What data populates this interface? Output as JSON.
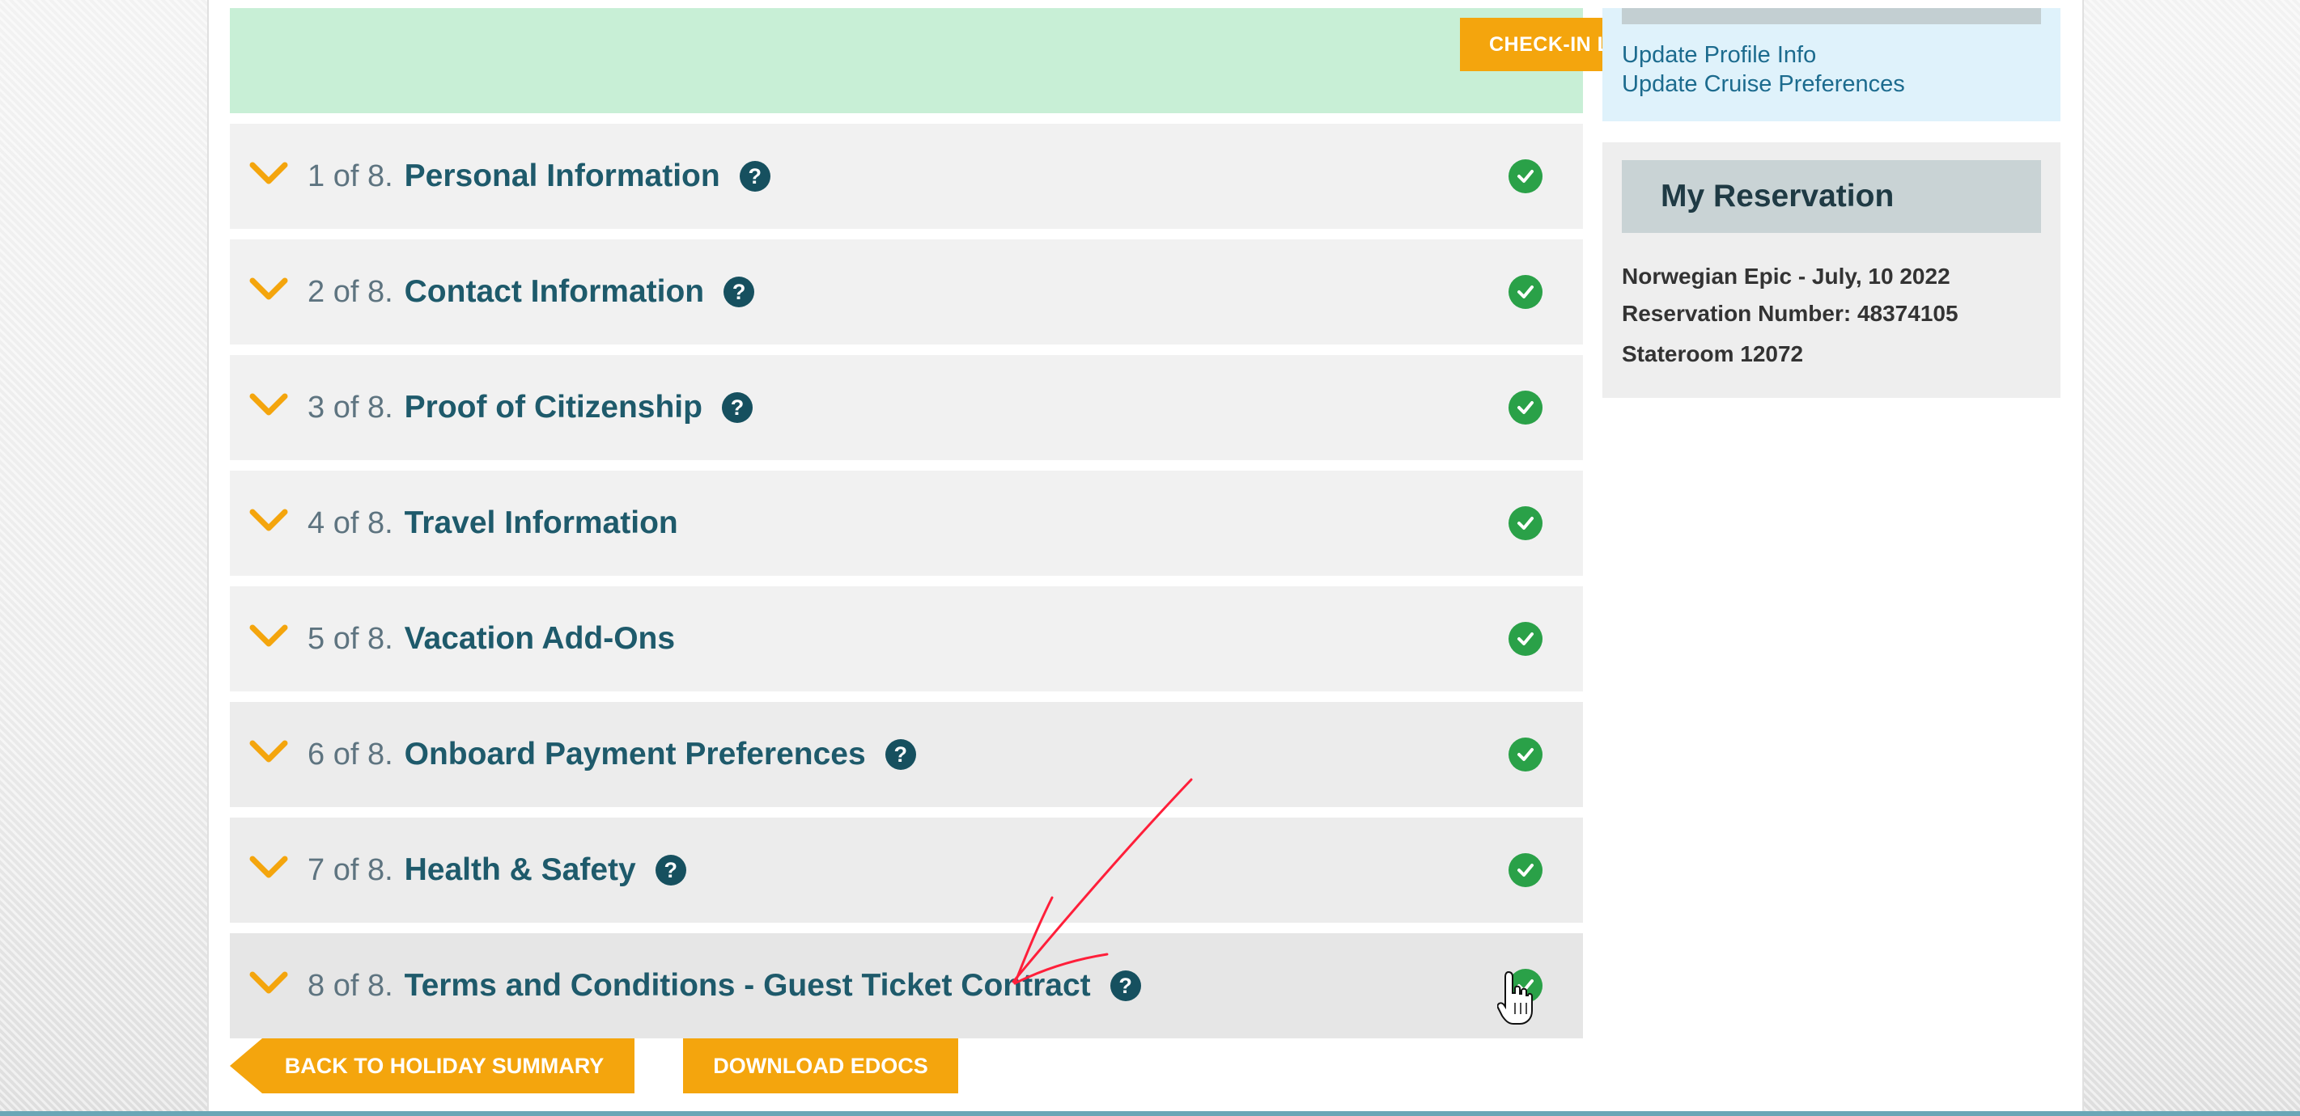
{
  "checkin": {
    "button_label": "CHECK-IN LOTTE"
  },
  "steps": [
    {
      "number": "1 of 8.",
      "title": "Personal Information",
      "has_help": true,
      "complete": true
    },
    {
      "number": "2 of 8.",
      "title": "Contact Information",
      "has_help": true,
      "complete": true
    },
    {
      "number": "3 of 8.",
      "title": "Proof of Citizenship",
      "has_help": true,
      "complete": true
    },
    {
      "number": "4 of 8.",
      "title": "Travel Information",
      "has_help": false,
      "complete": true
    },
    {
      "number": "5 of 8.",
      "title": "Vacation Add-Ons",
      "has_help": false,
      "complete": true
    },
    {
      "number": "6 of 8.",
      "title": "Onboard Payment Preferences",
      "has_help": true,
      "complete": true
    },
    {
      "number": "7 of 8.",
      "title": "Health & Safety",
      "has_help": true,
      "complete": true
    },
    {
      "number": "8 of 8.",
      "title": "Terms and Conditions - Guest Ticket Contract",
      "has_help": true,
      "complete": true
    }
  ],
  "help_glyph": "?",
  "footer": {
    "back_label": "BACK TO HOLIDAY SUMMARY",
    "edocs_label": "DOWNLOAD EDOCS"
  },
  "profile": {
    "links": [
      "Update Profile Info",
      "Update Cruise Preferences"
    ]
  },
  "reservation": {
    "title": "My Reservation",
    "ship_date": "Norwegian Epic - July, 10 2022",
    "reservation_number": "Reservation Number: 48374105",
    "stateroom": "Stateroom 12072"
  },
  "icons": {
    "chevron": "chevron-down-icon",
    "help": "help-icon",
    "check": "check-circle-icon",
    "cursor": "hand-pointer-icon"
  },
  "colors": {
    "accent_orange": "#f4a50d",
    "title_teal": "#1e5a6b",
    "check_green": "#2aa148",
    "link_blue": "#1c6b8e",
    "annotation_red": "#ff1f3a"
  }
}
